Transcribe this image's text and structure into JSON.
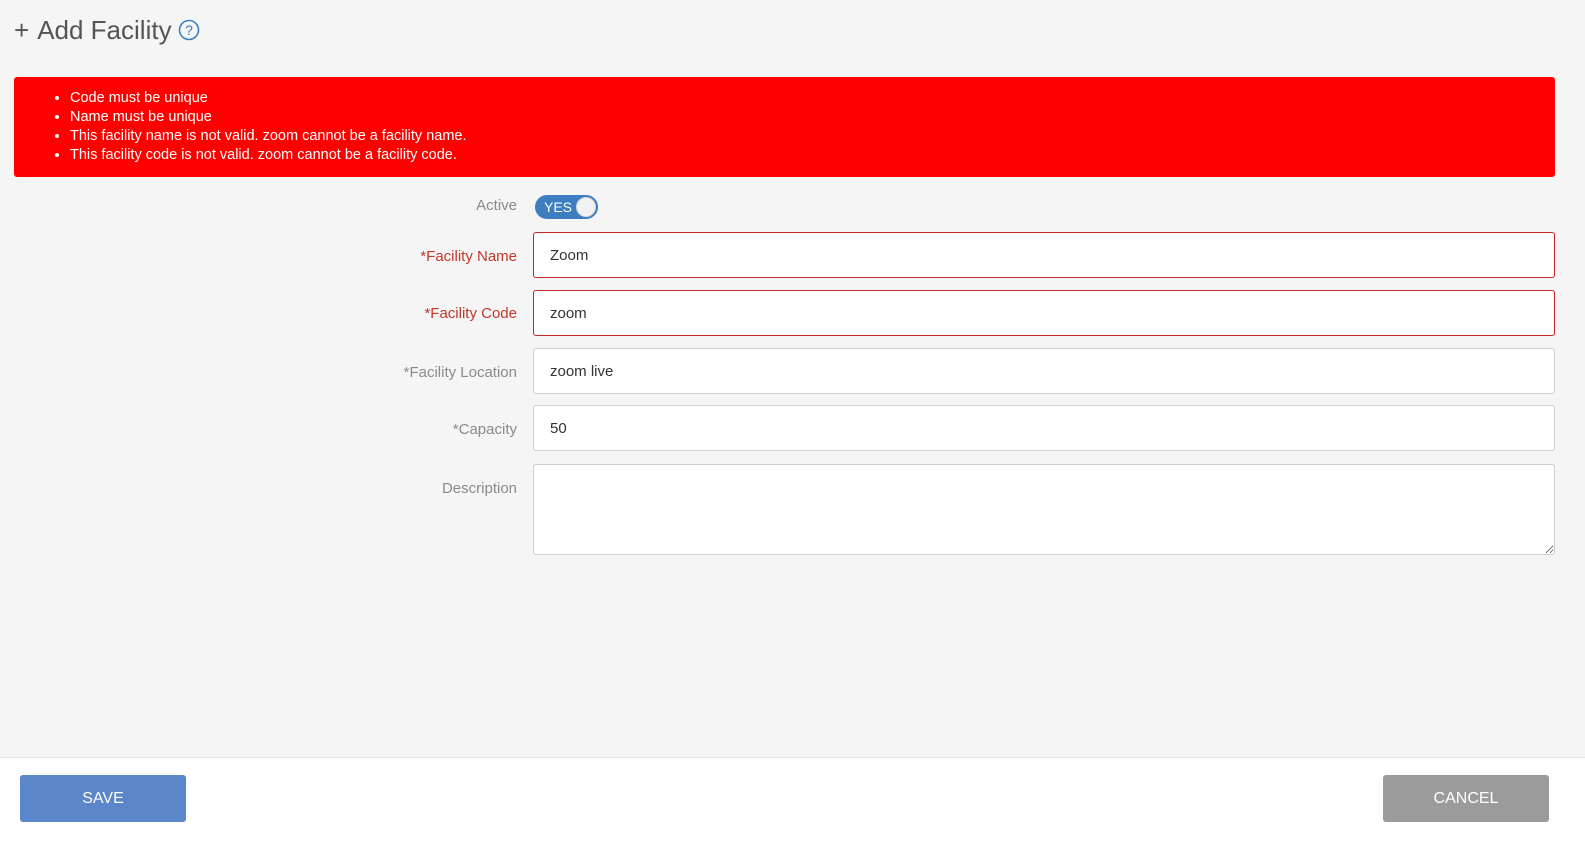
{
  "header": {
    "plus": "+",
    "title": "Add Facility",
    "help_icon": "question-circle-icon"
  },
  "alert": {
    "color": "#ff0000",
    "messages": [
      "Code must be unique",
      "Name must be unique",
      "This facility name is not valid. zoom cannot be a facility name.",
      "This facility code is not valid. zoom cannot be a facility code."
    ]
  },
  "form": {
    "active": {
      "label": "Active",
      "toggle_text": "YES",
      "value": true
    },
    "facility_name": {
      "label": "*Facility Name",
      "value": "Zoom",
      "error": true
    },
    "facility_code": {
      "label": "*Facility Code",
      "value": "zoom",
      "error": true
    },
    "facility_location": {
      "label": "*Facility Location",
      "value": "zoom live"
    },
    "capacity": {
      "label": "*Capacity",
      "value": "50"
    },
    "description": {
      "label": "Description",
      "value": ""
    }
  },
  "footer": {
    "save_label": "SAVE",
    "cancel_label": "CANCEL"
  },
  "colors": {
    "accent": "#3d7ec0",
    "save": "#5b86c9",
    "cancel": "#9b9b9b",
    "error": "#c62828"
  }
}
